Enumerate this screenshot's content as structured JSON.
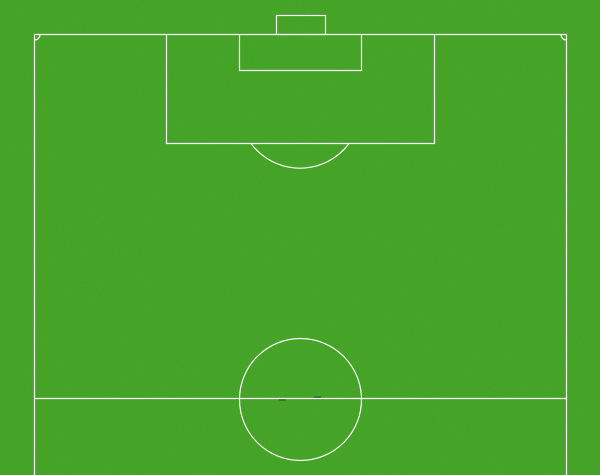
{
  "pitch": {
    "turf_color": "#4aa92c",
    "turf_dark_color": "#43a026",
    "line_color": "#ffffff"
  },
  "players": [
    {
      "marker": "player-marker",
      "color": "#3a5a2a"
    },
    {
      "marker": "player-marker",
      "color": "#3a5a2a"
    }
  ]
}
